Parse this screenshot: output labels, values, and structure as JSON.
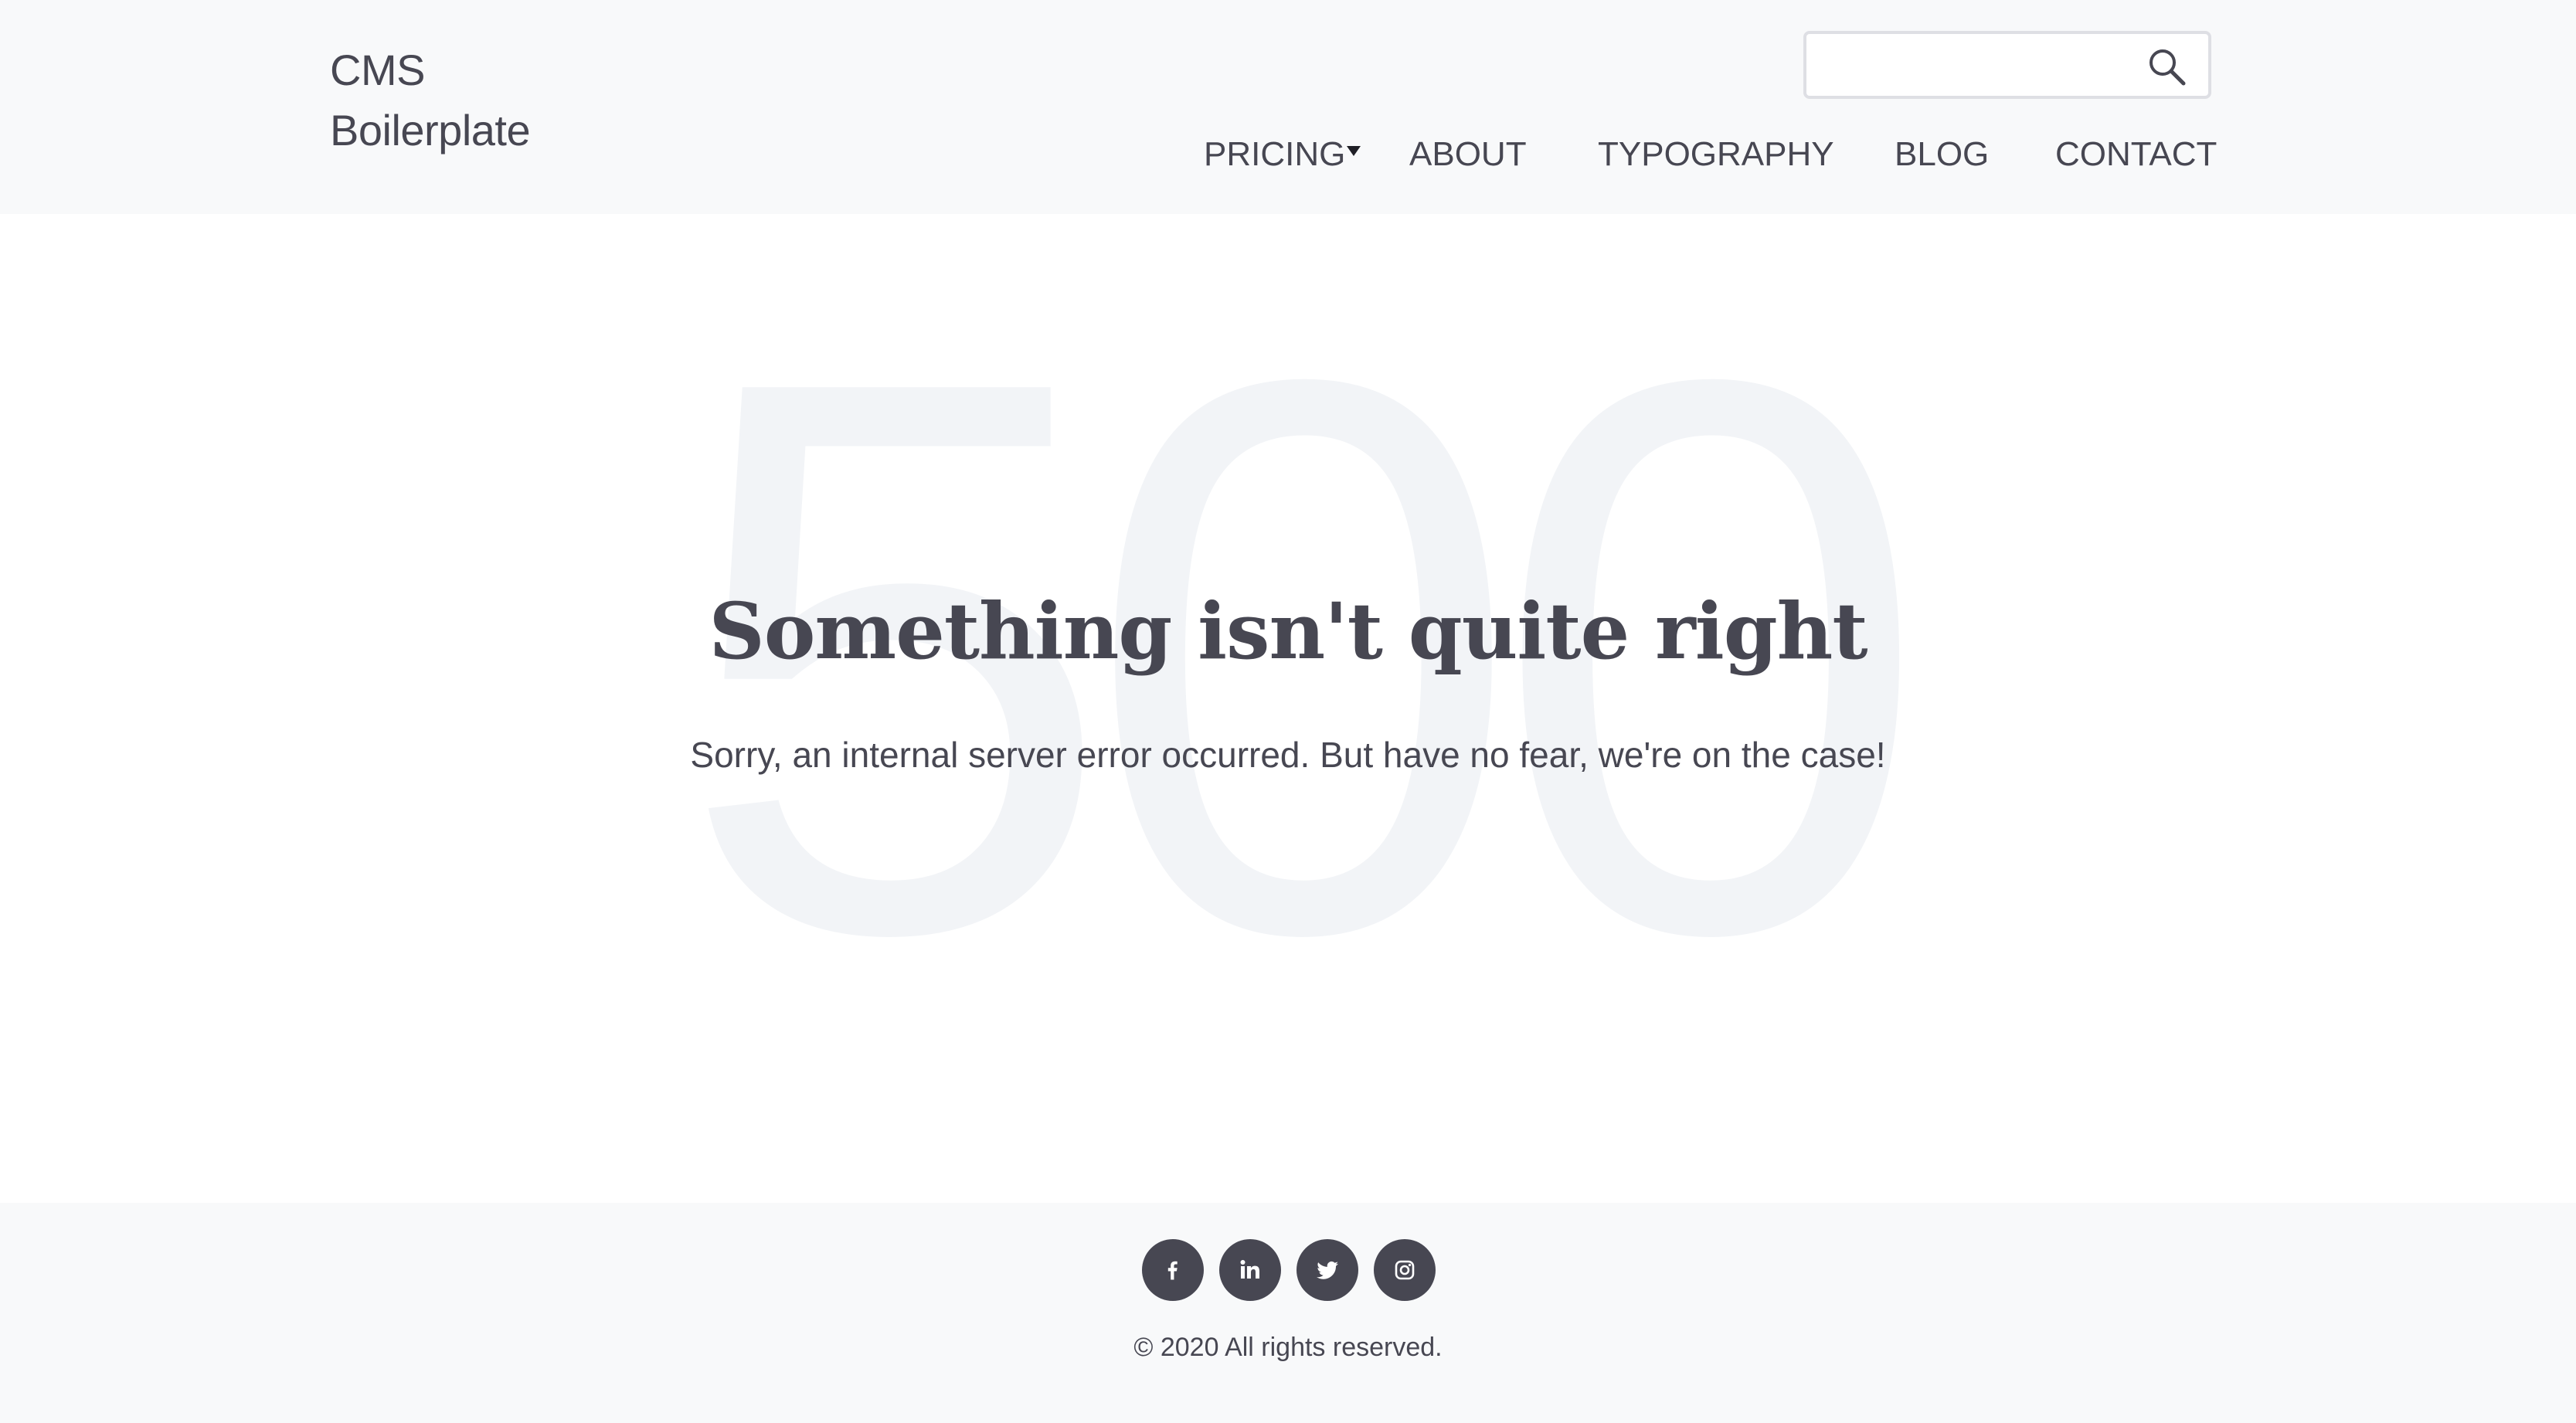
{
  "header": {
    "logo_line1": "CMS",
    "logo_line2": "Boilerplate",
    "search": {
      "value": "",
      "placeholder": ""
    },
    "nav": {
      "pricing": "PRICING",
      "about": "ABOUT",
      "typography": "TYPOGRAPHY",
      "blog": "BLOG",
      "contact": "CONTACT"
    }
  },
  "main": {
    "error_code": "500",
    "headline": "Something isn't quite right",
    "message": "Sorry, an internal server error occurred. But have no fear, we're on the case!"
  },
  "footer": {
    "social": [
      "facebook-icon",
      "linkedin-icon",
      "twitter-icon",
      "instagram-icon"
    ],
    "copyright": "© 2020 All rights reserved."
  },
  "colors": {
    "text": "#474752",
    "header_bg": "#f8f9fa",
    "footer_bg": "#f8f9fa",
    "watermark": "#f2f4f7",
    "search_border": "#dedfe4"
  }
}
